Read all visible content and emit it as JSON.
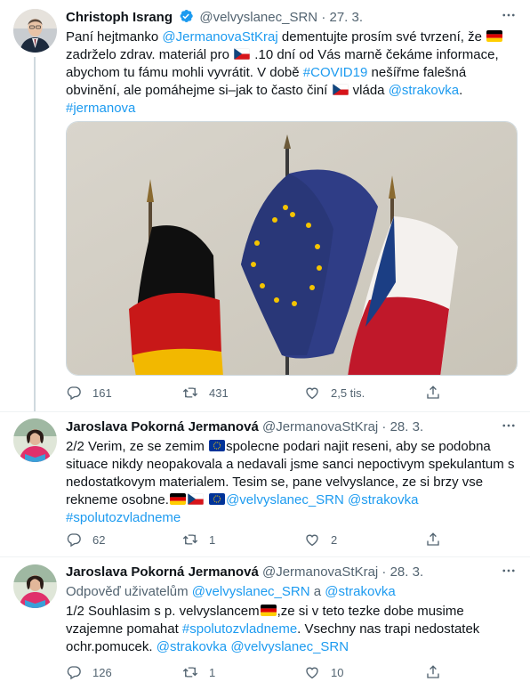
{
  "tweets": [
    {
      "name": "Christoph Israng",
      "handle": "@velvyslanec_SRN",
      "sep": "·",
      "date": "27. 3.",
      "text": {
        "t1": "Paní hejtmanko ",
        "m1": "@JermanovaStKraj",
        "t2": " dementujte prosím své tvrzení, že ",
        "t3": " zadrželo zdrav. materiál pro ",
        "t4": " .10 dní od Vás marně čekáme informace, abychom tu fámu mohli vyvrátit. V době ",
        "h1": "#COVID19",
        "t5": " nešířme falešná obvinění, ale pomáhejme si–jak to často činí ",
        "t6": " vláda ",
        "m2": "@strakovka",
        "t7": ".",
        "h2": "#jermanova"
      },
      "actions": {
        "replies": "161",
        "retweets": "431",
        "likes": "2,5 tis."
      }
    },
    {
      "name": "Jaroslava Pokorná Jermanová",
      "handle": "@JermanovaStKraj",
      "sep": "·",
      "date": "28. 3.",
      "text": {
        "t1": "2/2 Verim, ze se zemim ",
        "t2": "spolecne podari najit reseni, aby se podobna situace nikdy neopakovala a nedavali jsme sanci nepoctivym spekulantum s nedostatkovym materialem. Tesim se, pane velvyslance, ze si brzy vse rekneme osobne.",
        "m1": "@velvyslanec_SRN",
        "m2": "@strakovka",
        "h1": "#spolutozvladneme"
      },
      "actions": {
        "replies": "62",
        "retweets": "1",
        "likes": "2"
      }
    },
    {
      "name": "Jaroslava Pokorná Jermanová",
      "handle": "@JermanovaStKraj",
      "sep": "·",
      "date": "28. 3.",
      "reply_to": {
        "prefix": "Odpověď uživatelům ",
        "u1": "@velvyslanec_SRN",
        "and": " a ",
        "u2": "@strakovka"
      },
      "text": {
        "t1": "1/2 Souhlasim s p. velvyslancem",
        "t2": ",ze si v teto tezke dobe musime vzajemne pomahat ",
        "h1": "#spolutozvladneme",
        "t3": ". Vsechny nas trapi nedostatek ochr.pomucek. ",
        "m1": "@strakovka",
        "m2": "@velvyslanec_SRN"
      },
      "actions": {
        "replies": "126",
        "retweets": "1",
        "likes": "10"
      }
    }
  ],
  "colors": {
    "link": "#1d9bf0",
    "muted": "#536471",
    "verified": "#1d9bf0"
  },
  "icons": [
    "reply-icon",
    "retweet-icon",
    "like-icon",
    "share-icon",
    "more-icon",
    "verified-icon"
  ]
}
